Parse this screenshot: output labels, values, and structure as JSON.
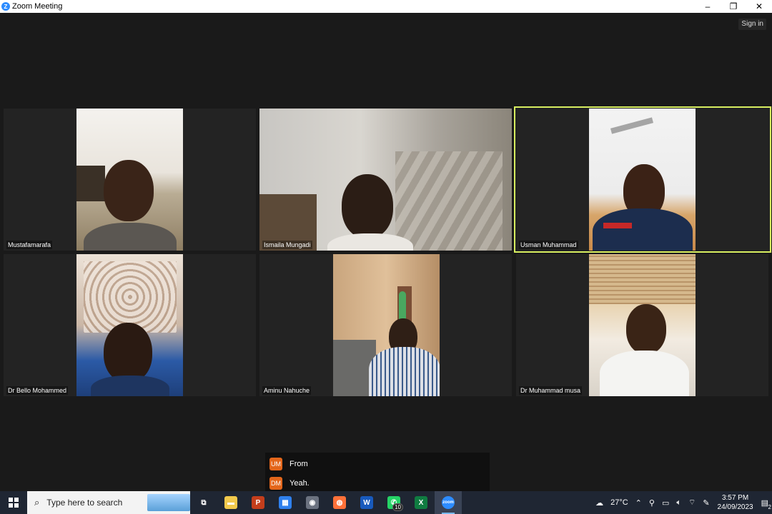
{
  "window": {
    "title": "Zoom Meeting",
    "logo_letter": "Z",
    "controls": [
      "–",
      "❐",
      "✕"
    ]
  },
  "signin_label": "Sign in",
  "participants": [
    {
      "name": "Mustafamarafa"
    },
    {
      "name": "Ismaila Mungadi"
    },
    {
      "name": "Usman Muhammad"
    },
    {
      "name": "Dr Bello Mohammed"
    },
    {
      "name": "Aminu Nahuche"
    },
    {
      "name": "Dr Muhammad musa"
    }
  ],
  "chat": {
    "messages": [
      {
        "initials": "UM",
        "text": "From"
      },
      {
        "initials": "DM",
        "text": "Yeah."
      }
    ]
  },
  "taskbar": {
    "search_placeholder": "Type here to search",
    "apps": [
      {
        "icon": "task-view-icon",
        "label": "⧉",
        "color": "#1f2633"
      },
      {
        "icon": "file-explorer-icon",
        "label": "▬",
        "color": "#f2c94c"
      },
      {
        "icon": "powerpoint-icon",
        "label": "P",
        "color": "#c43e1c"
      },
      {
        "icon": "store-icon",
        "label": "▦",
        "color": "#2f80ed"
      },
      {
        "icon": "camera-icon",
        "label": "◉",
        "color": "#6b7280"
      },
      {
        "icon": "firefox-icon",
        "label": "◍",
        "color": "#ff7139"
      },
      {
        "icon": "word-icon",
        "label": "W",
        "color": "#185abd"
      },
      {
        "icon": "whatsapp-icon",
        "label": "✆",
        "color": "#25d366",
        "badge": "10"
      },
      {
        "icon": "excel-icon",
        "label": "X",
        "color": "#107c41"
      },
      {
        "icon": "zoom-icon",
        "label": "zoom",
        "color": "#2d8cff",
        "active": true
      }
    ],
    "weather": "27°C",
    "time": "3:57 PM",
    "date": "24/09/2023",
    "notification_count": "2"
  }
}
